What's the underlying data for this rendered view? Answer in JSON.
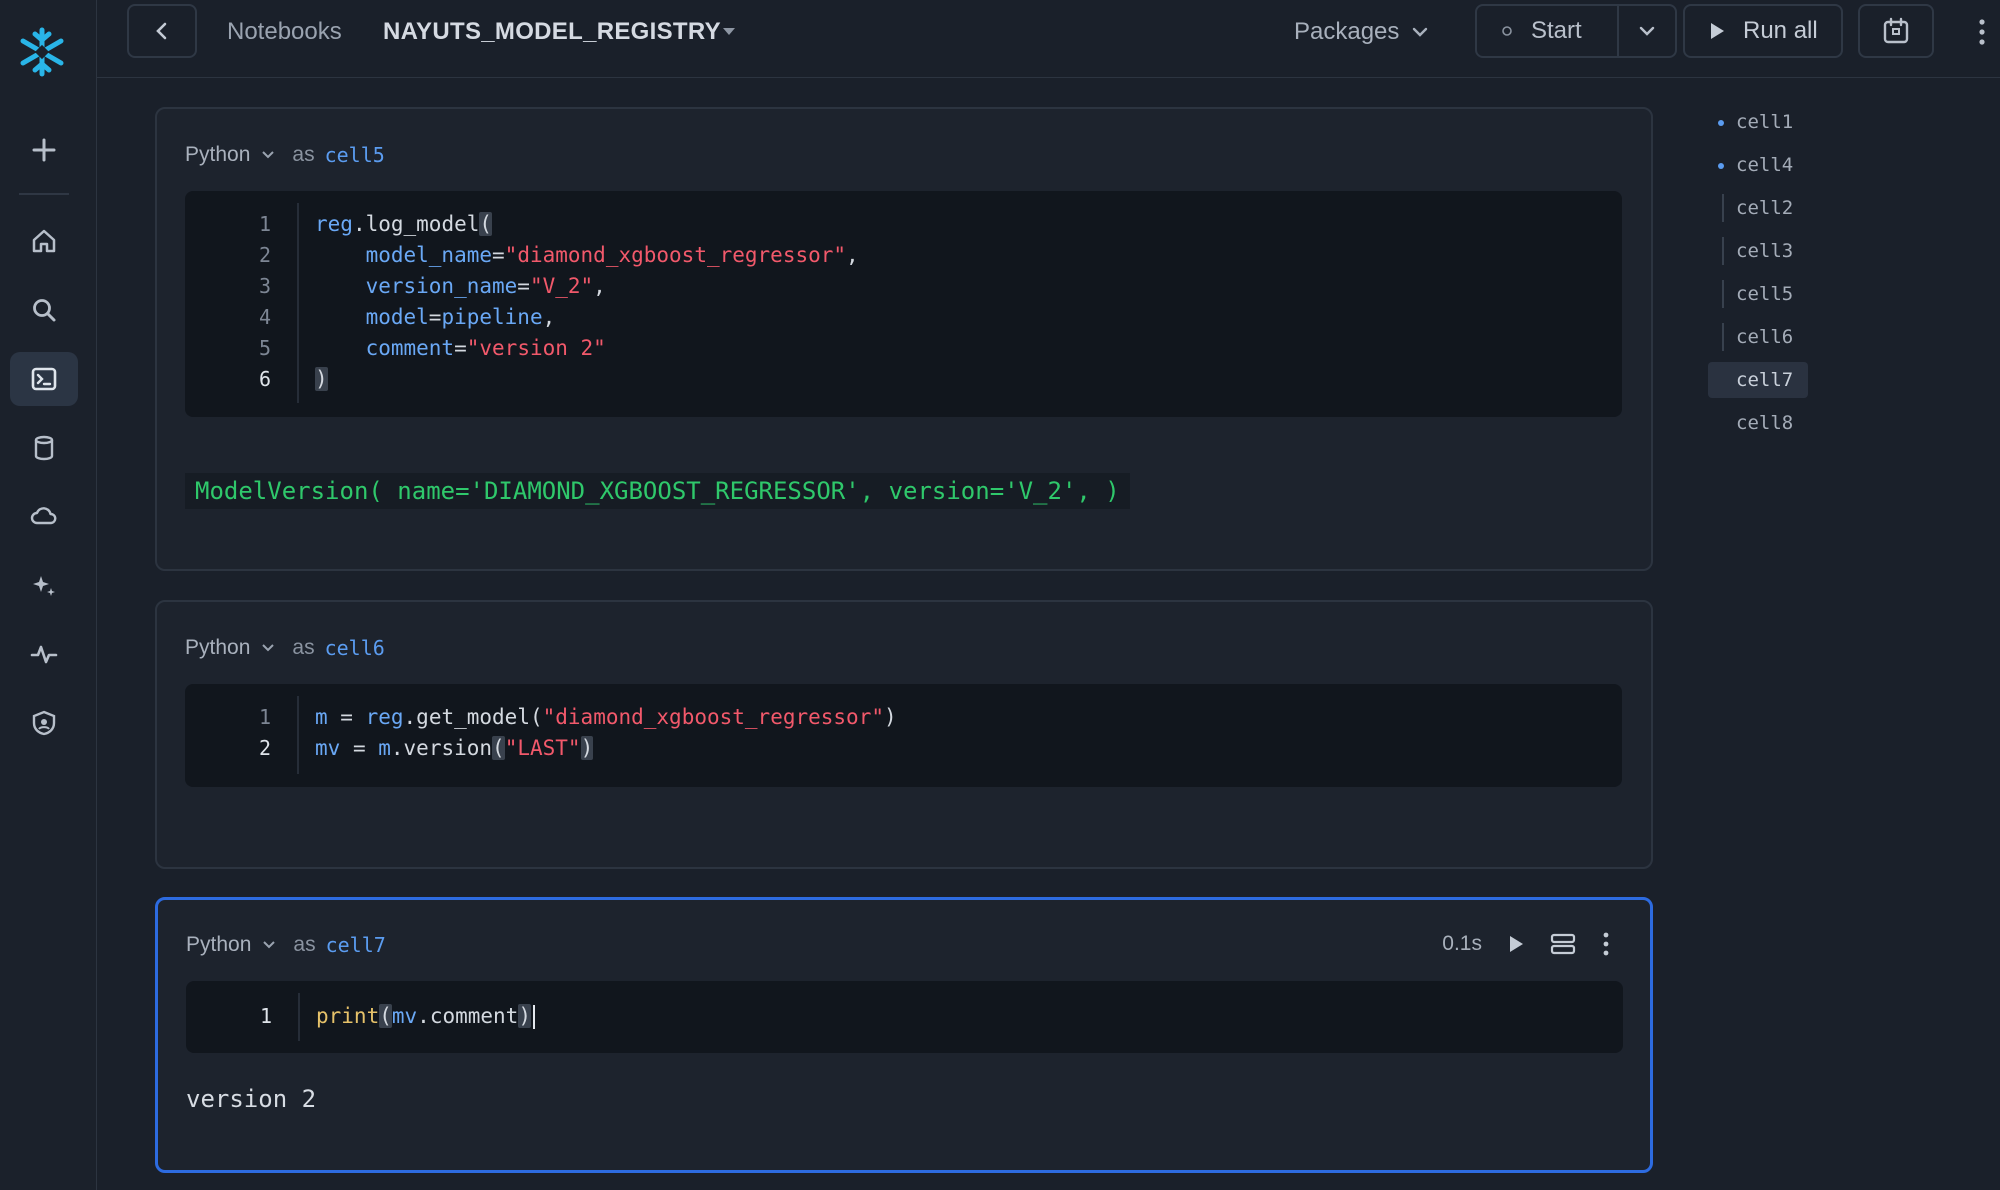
{
  "topbar": {
    "breadcrumb": "Notebooks",
    "notebook_title": "NAYUTS_MODEL_REGISTRY",
    "packages_label": "Packages",
    "start_label": "Start",
    "run_all_label": "Run all"
  },
  "cells": [
    {
      "lang": "Python",
      "as": "as",
      "name": "cell5",
      "line_numbers": [
        "1",
        "2",
        "3",
        "4",
        "5",
        "6"
      ],
      "output": "ModelVersion( name='DIAMOND_XGBOOST_REGRESSOR', version='V_2', )"
    },
    {
      "lang": "Python",
      "as": "as",
      "name": "cell6",
      "line_numbers": [
        "1",
        "2"
      ]
    },
    {
      "lang": "Python",
      "as": "as",
      "name": "cell7",
      "line_numbers": [
        "1"
      ],
      "exec_time": "0.1s",
      "output": "version 2"
    }
  ],
  "code": {
    "c5": {
      "l1_var": "reg",
      "l1_rest": ".log_model",
      "l2_key": "model_name",
      "l2_val": "\"diamond_xgboost_regressor\"",
      "l3_key": "version_name",
      "l3_val": "\"V_2\"",
      "l4_key": "model",
      "l4_val": "pipeline",
      "l5_key": "comment",
      "l5_val": "\"version 2\""
    },
    "c6": {
      "l1_a": "m",
      "l1_b": "reg",
      "l1_c": ".get_model",
      "l1_str": "\"diamond_xgboost_regressor\"",
      "l2_a": "mv",
      "l2_b": "m",
      "l2_c": ".version",
      "l2_str": "\"LAST\""
    },
    "c7": {
      "l1_fn": "print",
      "l1_var": "mv",
      "l1_rest": ".comment"
    }
  },
  "outline": [
    "cell1",
    "cell4",
    "cell2",
    "cell3",
    "cell5",
    "cell6",
    "cell7",
    "cell8"
  ],
  "colors": {
    "accent": "#2d6be0",
    "output_green": "#2fc86b",
    "string": "#f2596b",
    "variable": "#6aa8f5",
    "function": "#e6c26a"
  },
  "icons": [
    "snowflake-logo",
    "plus-icon",
    "home-icon",
    "search-icon",
    "notebook-icon",
    "database-icon",
    "cloud-icon",
    "sparkle-icon",
    "activity-icon",
    "shield-icon",
    "chevron-left-icon",
    "caret-down-icon",
    "chevron-down-icon",
    "play-icon",
    "calendar-icon",
    "kebab-icon",
    "layers-icon"
  ]
}
